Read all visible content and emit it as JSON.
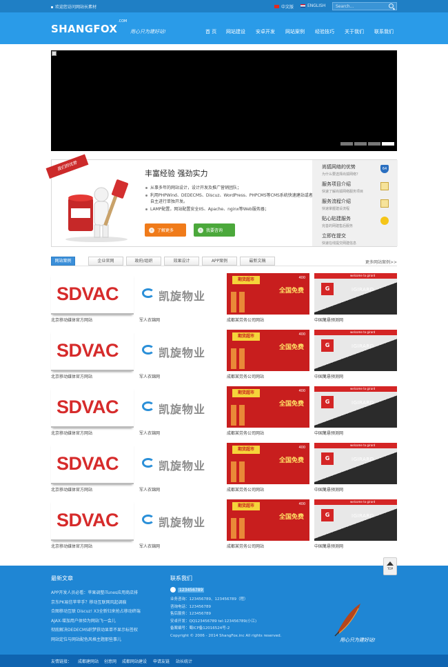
{
  "topbar": {
    "welcome": "欢迎您访问网站长素材",
    "lang_cn": "中文版",
    "lang_en": "ENGLISH",
    "search_placeholder": "Search..."
  },
  "header": {
    "logo": "SHANGFOX",
    "logo_suffix": ".COM",
    "slogan": "用心只为建好站!",
    "nav": [
      "首 页",
      "网站建设",
      "安卓开发",
      "网站案例",
      "经验技巧",
      "关于我们",
      "联系我们"
    ]
  },
  "banner": {
    "slides": 4,
    "active_index": 3
  },
  "advantage": {
    "ribbon": "我们的优势",
    "title": "丰富经验 强劲实力",
    "points": [
      "从事多年的网站设计，设计开发及推广营销团队；",
      "利用PHPWind、DEDECMS、Discuz、WordPress、PHPCMS等CMS系统快速建站或者自主进行单独开发。",
      "LAMP配置，网站配置安全IIS、Apache、nginx等Web服务器；"
    ],
    "btn_more": "了解更多",
    "btn_consult": "我要咨询",
    "side": [
      {
        "title": "尚狐网络的优势",
        "desc": "为什么要选择尚狐网络？",
        "icon": "shield-icon",
        "badge": "64"
      },
      {
        "title": "服务项目介绍",
        "desc": "快速了解尚狐网络服务项目",
        "icon": "note-icon"
      },
      {
        "title": "服务流程介绍",
        "desc": "快速掌握建设流程",
        "icon": "note-icon"
      },
      {
        "title": "贴心贴建服务",
        "desc": "完善的网建售后服务",
        "icon": "smile-icon"
      },
      {
        "title": "立即在提交",
        "desc": "快速在线提交网建信息",
        "icon": ""
      }
    ]
  },
  "tabs": {
    "items": [
      "网站案例",
      "企业官网",
      "政府/组织",
      "效果设计",
      "APP案例",
      "最新文稿"
    ],
    "active": 0,
    "more": "更多网站案例>>"
  },
  "cases": {
    "sdvac": {
      "logo_text": "SDVAC",
      "caption": "北京移动媒体官方网站"
    },
    "kai": {
      "logo_text": "凯旋物业",
      "caption": "军人衣锦网"
    },
    "promo": {
      "text1": "期货超市",
      "text2": "全国免费",
      "text3": "400",
      "caption": "成都某劳务公司网站"
    },
    "igirard": {
      "logo_text": "IGIRARD",
      "top_text": "welcome to girard",
      "mark": "G",
      "caption": "中国篱悬预测网"
    }
  },
  "footer": {
    "news_title": "最新文章",
    "news": [
      "APP开发人员必看：苹果调整iTunes应用商店排",
      "京东PK易信苹苹手？移动互联网风起调痕",
      "合图移动互联 Discuz! X3全新归来抢占移动终端",
      "AJAX-增加用户体验为网站飞一会儿",
      "彻底解决DEDECMS织梦获动显单不显示标签权",
      "网站定位与网站配色风格主题那些事儿"
    ],
    "contact_title": "联系我们",
    "qq": "123456789",
    "contact_lines": [
      "业务咨询：123456789、123456789（程）",
      "咨询电话：123456789",
      "售后服务：123456789",
      "安卓开发：QQ123456789 tel:123456789(小江)",
      "备案编号：蜀ICP备12016524号-2",
      "Copyright © 2006 - 2014 ShangFox.inc All rights reserved."
    ],
    "slogan": "用心只为建好站!",
    "top_label": "TOP"
  },
  "links": {
    "label": "友情链接：",
    "items": [
      "成都建网站",
      "创意网",
      "成都网站建设",
      "申请友链",
      "站长统计"
    ]
  }
}
